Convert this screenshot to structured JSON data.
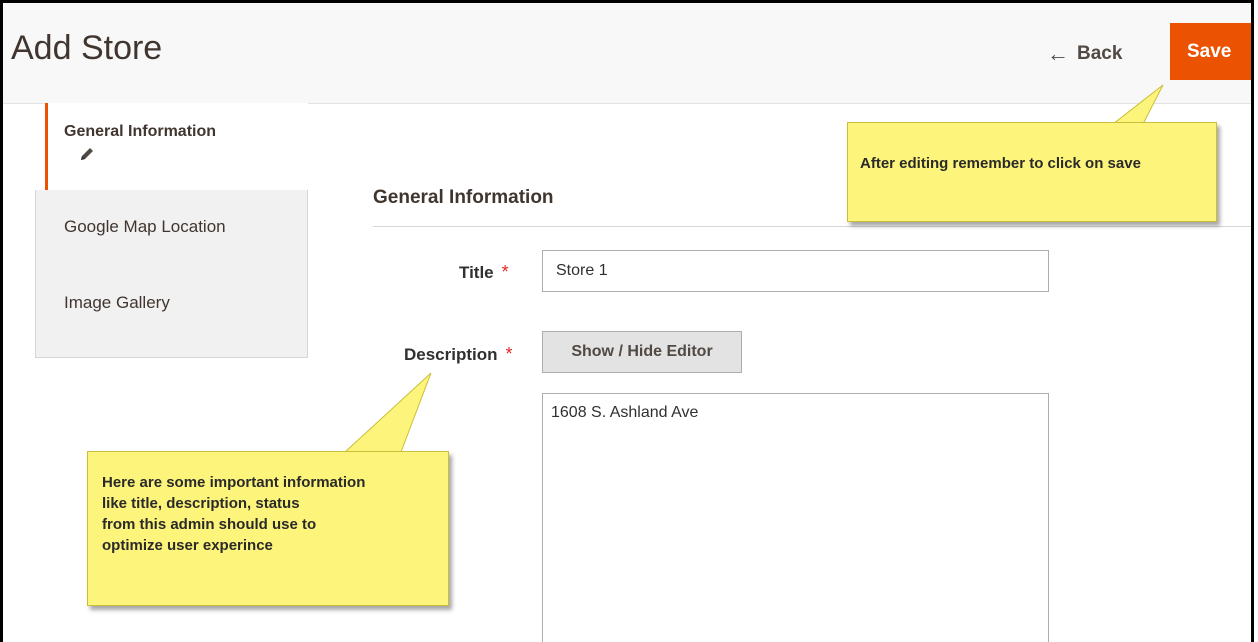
{
  "header": {
    "title": "Add Store",
    "back_label": "Back",
    "save_label": "Save"
  },
  "sidebar": {
    "items": [
      {
        "label": "General Information",
        "active": true,
        "icon": "pencil-icon"
      },
      {
        "label": "Google Map Location",
        "active": false
      },
      {
        "label": "Image Gallery",
        "active": false
      }
    ]
  },
  "form": {
    "section_title": "General Information",
    "title_label": "Title",
    "title_value": "Store 1",
    "description_label": "Description",
    "editor_toggle_label": "Show / Hide Editor",
    "description_value": "1608 S. Ashland Ave",
    "required_marker": "*"
  },
  "callouts": {
    "save_note": "After editing remember to click on save",
    "info_note_lines": [
      "Here are some important information",
      "like title, description, status",
      "from this admin should use to",
      "optimize user experince"
    ]
  },
  "colors": {
    "accent": "#eb5202",
    "required": "#e22626",
    "callout": "#fdf57b"
  }
}
